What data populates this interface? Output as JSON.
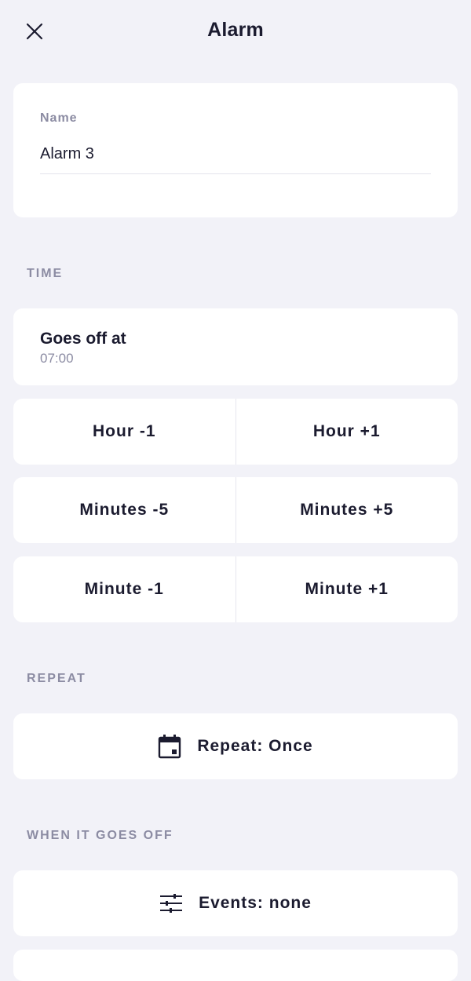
{
  "header": {
    "title": "Alarm",
    "close_icon": "close-icon"
  },
  "name_section": {
    "label": "Name",
    "value": "Alarm 3"
  },
  "time_section": {
    "label": "TIME",
    "goes_off_title": "Goes off at",
    "goes_off_value": "07:00",
    "buttons": {
      "hour_minus": "Hour -1",
      "hour_plus": "Hour +1",
      "minutes_minus": "Minutes -5",
      "minutes_plus": "Minutes +5",
      "minute_minus": "Minute -1",
      "minute_plus": "Minute +1"
    }
  },
  "repeat_section": {
    "label": "REPEAT",
    "button_label": "Repeat: Once",
    "icon": "calendar-icon"
  },
  "events_section": {
    "label": "WHEN IT GOES OFF",
    "button_label": "Events: none",
    "icon": "sliders-icon"
  },
  "colors": {
    "background": "#f2f2f8",
    "card": "#ffffff",
    "text": "#1b1b2f",
    "muted": "#8c8ca3"
  }
}
